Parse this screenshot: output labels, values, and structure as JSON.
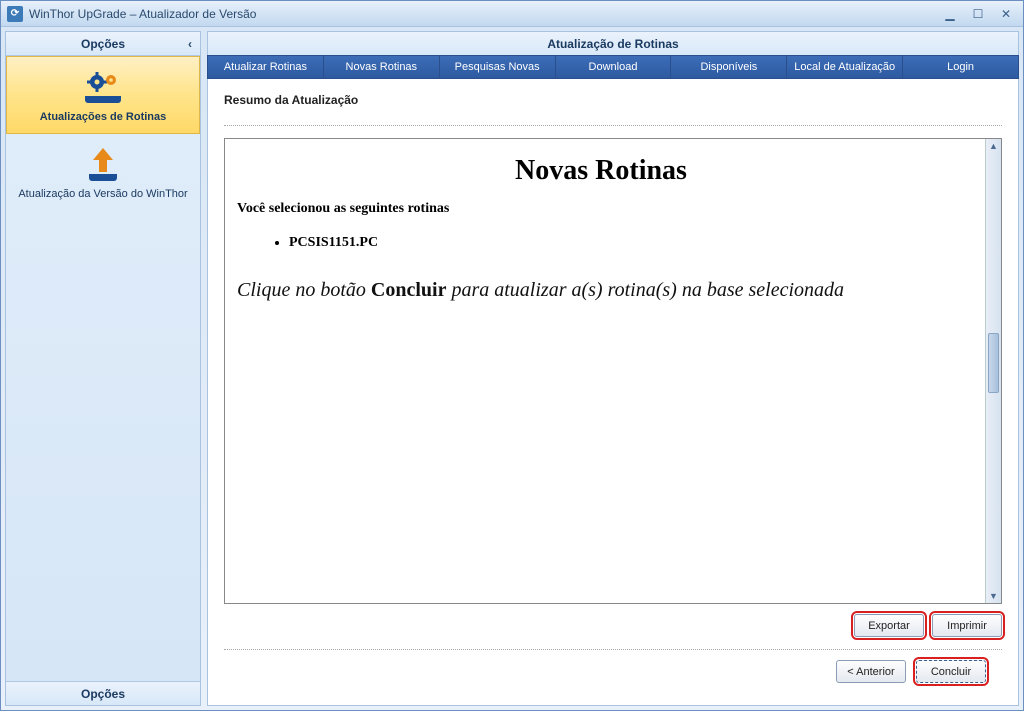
{
  "window": {
    "title": "WinThor UpGrade – Atualizador de Versão"
  },
  "sidebar": {
    "header": "Opções",
    "footer": "Opções",
    "items": [
      {
        "label": "Atualizações de Rotinas",
        "active": true
      },
      {
        "label": "Atualização da Versão do WinThor",
        "active": false
      }
    ]
  },
  "main": {
    "header": "Atualização de Rotinas",
    "tabs": [
      "Atualizar Rotinas",
      "Novas Rotinas",
      "Pesquisas Novas",
      "Download",
      "Disponíveis",
      "Local de Atualização",
      "Login"
    ],
    "section_title": "Resumo da Atualização",
    "summary": {
      "title": "Novas Rotinas",
      "selected_text": "Você selecionou as seguintes rotinas",
      "routines": [
        "PCSIS1151.PC"
      ],
      "instruction_pre": "Clique no botão ",
      "instruction_bold": "Concluir",
      "instruction_post": " para atualizar a(s) rotina(s) na base selecionada"
    },
    "buttons": {
      "export": "Exportar",
      "print": "Imprimir",
      "back": "< Anterior",
      "finish": "Concluir"
    }
  }
}
